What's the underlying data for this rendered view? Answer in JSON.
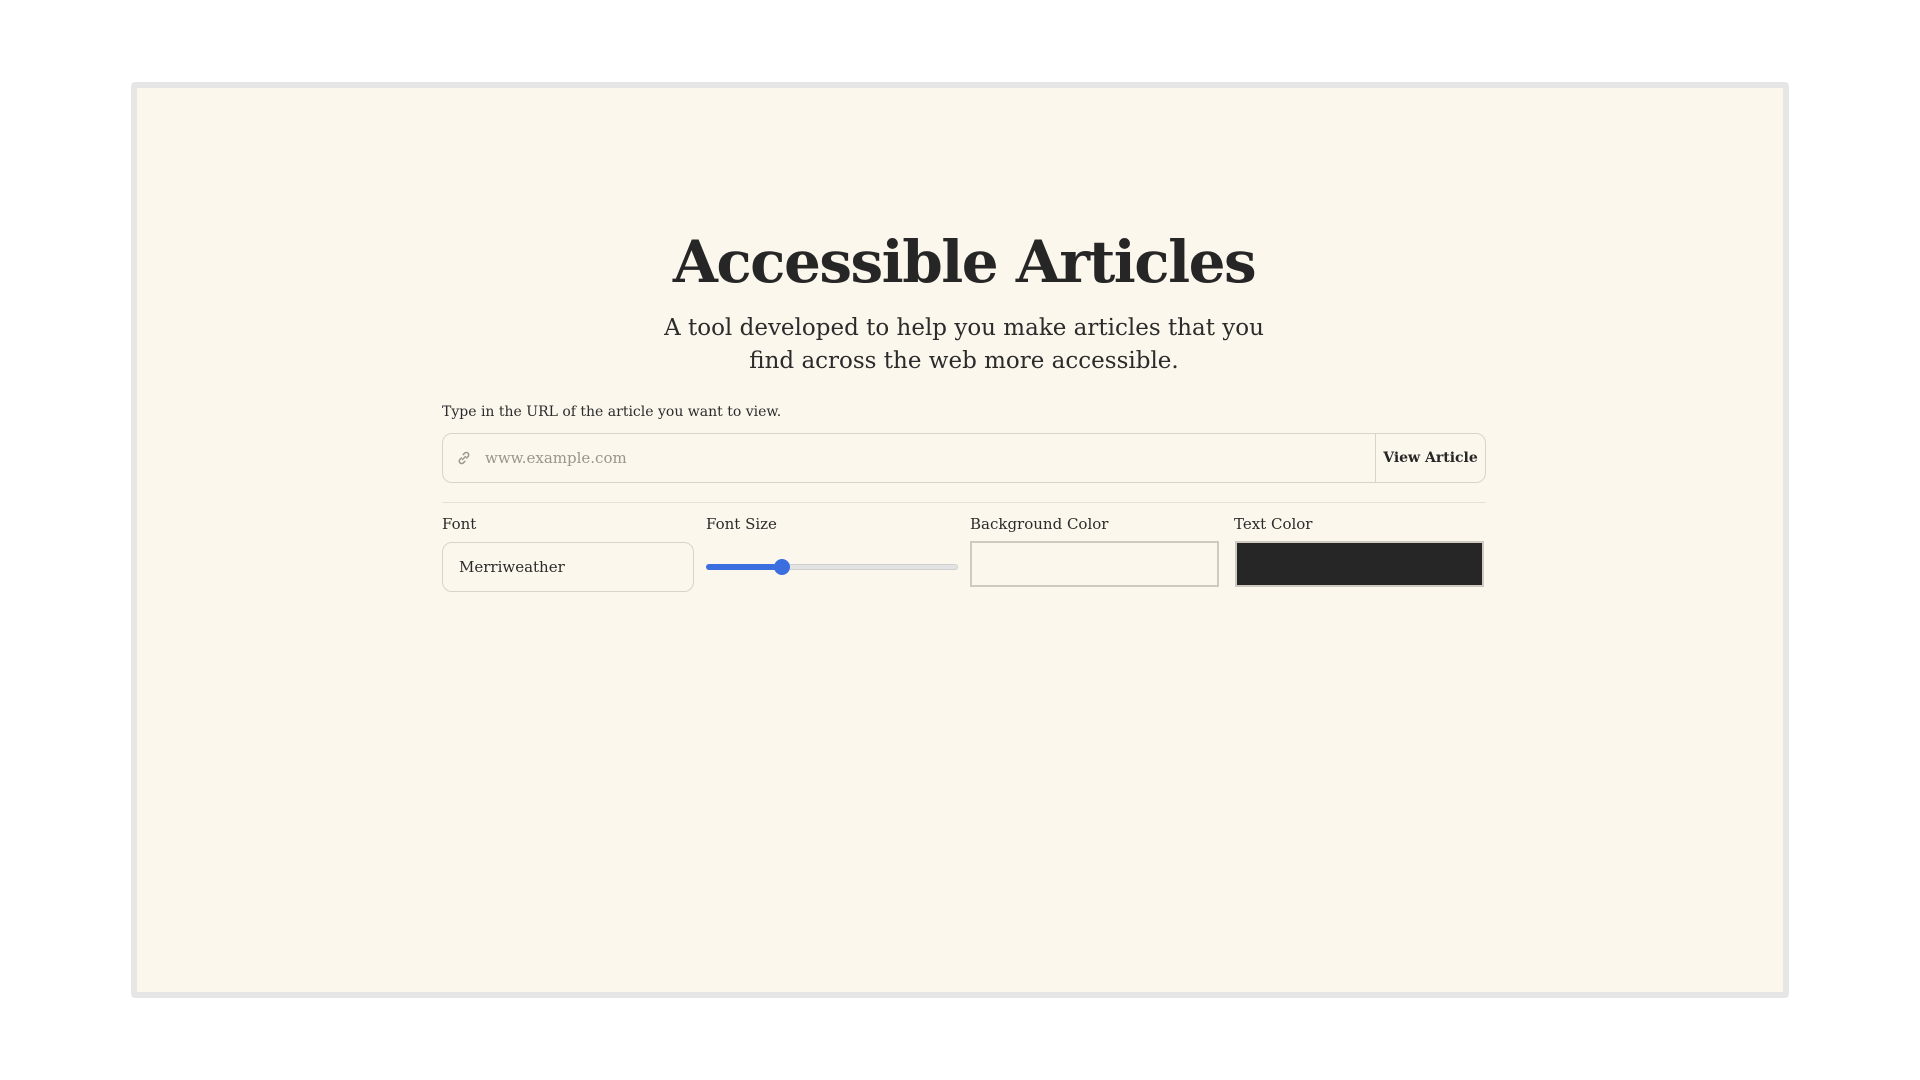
{
  "header": {
    "title": "Accessible Articles",
    "subtitle": "A tool developed to help you make articles that you find across the web more accessible."
  },
  "url_form": {
    "label": "Type in the URL of the article you want to view.",
    "icon": "link-icon",
    "placeholder": "www.example.com",
    "value": "",
    "button_label": "View Article"
  },
  "controls": {
    "font": {
      "label": "Font",
      "value": "Merriweather"
    },
    "font_size": {
      "label": "Font Size",
      "level": 0.3
    },
    "background_color": {
      "label": "Background Color",
      "value": "#fcf7ec"
    },
    "text_color": {
      "label": "Text Color",
      "value": "#262626"
    }
  },
  "colors": {
    "page_background": "#fcf7ec",
    "accent": "#3b6fe0",
    "text": "#262626"
  }
}
